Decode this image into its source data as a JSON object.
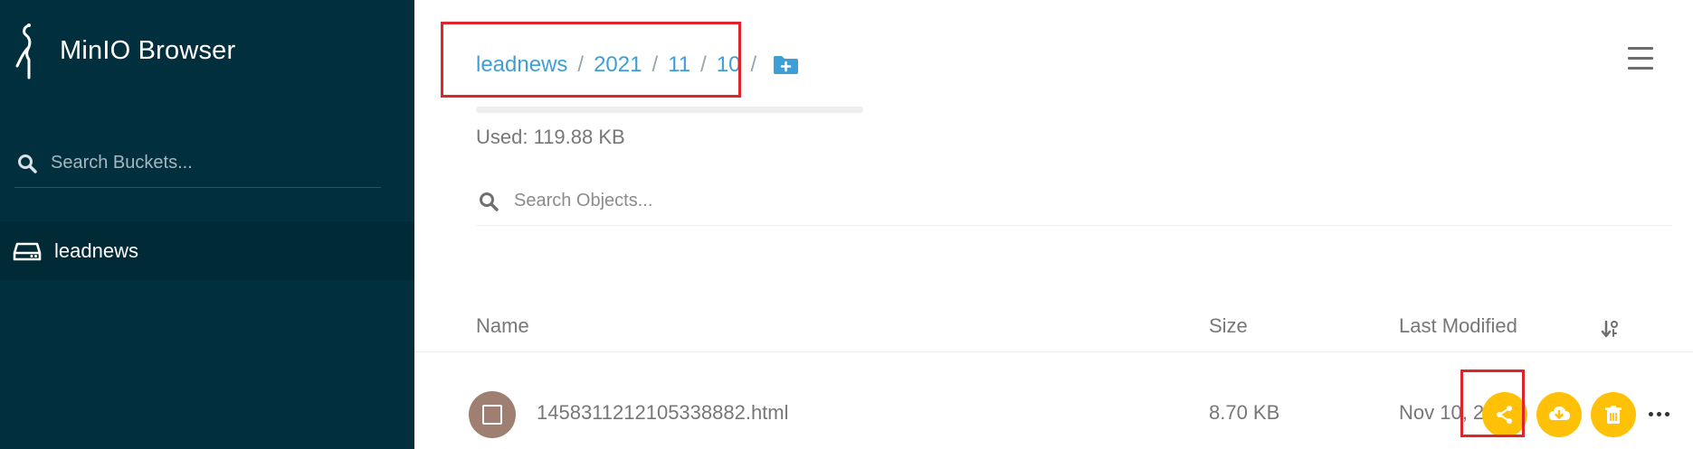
{
  "app": {
    "title": "MinIO Browser"
  },
  "sidebar": {
    "search_placeholder": "Search Buckets...",
    "buckets": [
      {
        "label": "leadnews"
      }
    ]
  },
  "breadcrumb": {
    "items": [
      "leadnews",
      "2021",
      "11",
      "10"
    ],
    "separator": "/"
  },
  "usage": {
    "text": "Used: 119.88 KB"
  },
  "object_search": {
    "placeholder": "Search Objects..."
  },
  "table": {
    "columns": {
      "name": "Name",
      "size": "Size",
      "modified": "Last Modified"
    },
    "rows": [
      {
        "name": "1458311212105338882.html",
        "size": "8.70 KB",
        "modified_visible": "Nov 10, 2"
      }
    ]
  },
  "icons": {
    "brand": "minio-logo-icon",
    "search": "search-icon",
    "bucket": "drive-icon",
    "new_folder": "folder-plus-icon",
    "menu": "hamburger-menu-icon",
    "sort": "sort-icon",
    "file": "file-icon",
    "share": "share-icon",
    "download": "cloud-download-icon",
    "delete": "trash-icon",
    "more": "more-horizontal-icon"
  },
  "colors": {
    "sidebar_bg": "#012f3e",
    "active_bucket_bg": "#002a36",
    "accent_blue": "#3e9fd6",
    "action_yellow": "#ffc107",
    "highlight_red": "#e0252a"
  }
}
